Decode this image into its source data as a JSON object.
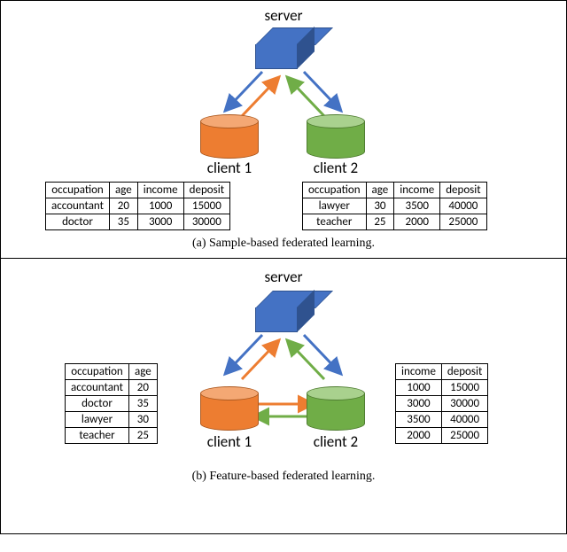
{
  "panelA": {
    "serverLabel": "server",
    "client1Label": "client 1",
    "client2Label": "client 2",
    "caption": "(a)  Sample-based federated learning.",
    "table1": {
      "headers": [
        "occupation",
        "age",
        "income",
        "deposit"
      ],
      "rows": [
        [
          "accountant",
          "20",
          "1000",
          "15000"
        ],
        [
          "doctor",
          "35",
          "3000",
          "30000"
        ]
      ]
    },
    "table2": {
      "headers": [
        "occupation",
        "age",
        "income",
        "deposit"
      ],
      "rows": [
        [
          "lawyer",
          "30",
          "3500",
          "40000"
        ],
        [
          "teacher",
          "25",
          "2000",
          "25000"
        ]
      ]
    }
  },
  "panelB": {
    "serverLabel": "server",
    "client1Label": "client 1",
    "client2Label": "client 2",
    "caption": "(b)  Feature-based federated learning.",
    "table1": {
      "headers": [
        "occupation",
        "age"
      ],
      "rows": [
        [
          "accountant",
          "20"
        ],
        [
          "doctor",
          "35"
        ],
        [
          "lawyer",
          "30"
        ],
        [
          "teacher",
          "25"
        ]
      ]
    },
    "table2": {
      "headers": [
        "income",
        "deposit"
      ],
      "rows": [
        [
          "1000",
          "15000"
        ],
        [
          "3000",
          "30000"
        ],
        [
          "3500",
          "40000"
        ],
        [
          "2000",
          "25000"
        ]
      ]
    }
  },
  "chart_data": [
    {
      "type": "table",
      "title": "Sample-based federated learning",
      "entities": {
        "server": 1,
        "clients": 2
      },
      "client1_data": [
        {
          "occupation": "accountant",
          "age": 20,
          "income": 1000,
          "deposit": 15000
        },
        {
          "occupation": "doctor",
          "age": 35,
          "income": 3000,
          "deposit": 30000
        }
      ],
      "client2_data": [
        {
          "occupation": "lawyer",
          "age": 30,
          "income": 3500,
          "deposit": 40000
        },
        {
          "occupation": "teacher",
          "age": 25,
          "income": 2000,
          "deposit": 25000
        }
      ],
      "communication": [
        "client1<->server",
        "client2<->server"
      ]
    },
    {
      "type": "table",
      "title": "Feature-based federated learning",
      "entities": {
        "server": 1,
        "clients": 2
      },
      "client1_data": [
        {
          "occupation": "accountant",
          "age": 20
        },
        {
          "occupation": "doctor",
          "age": 35
        },
        {
          "occupation": "lawyer",
          "age": 30
        },
        {
          "occupation": "teacher",
          "age": 25
        }
      ],
      "client2_data": [
        {
          "income": 1000,
          "deposit": 15000
        },
        {
          "income": 3000,
          "deposit": 30000
        },
        {
          "income": 3500,
          "deposit": 40000
        },
        {
          "income": 2000,
          "deposit": 25000
        }
      ],
      "communication": [
        "client1<->server",
        "client2<->server",
        "client1<->client2"
      ]
    }
  ]
}
